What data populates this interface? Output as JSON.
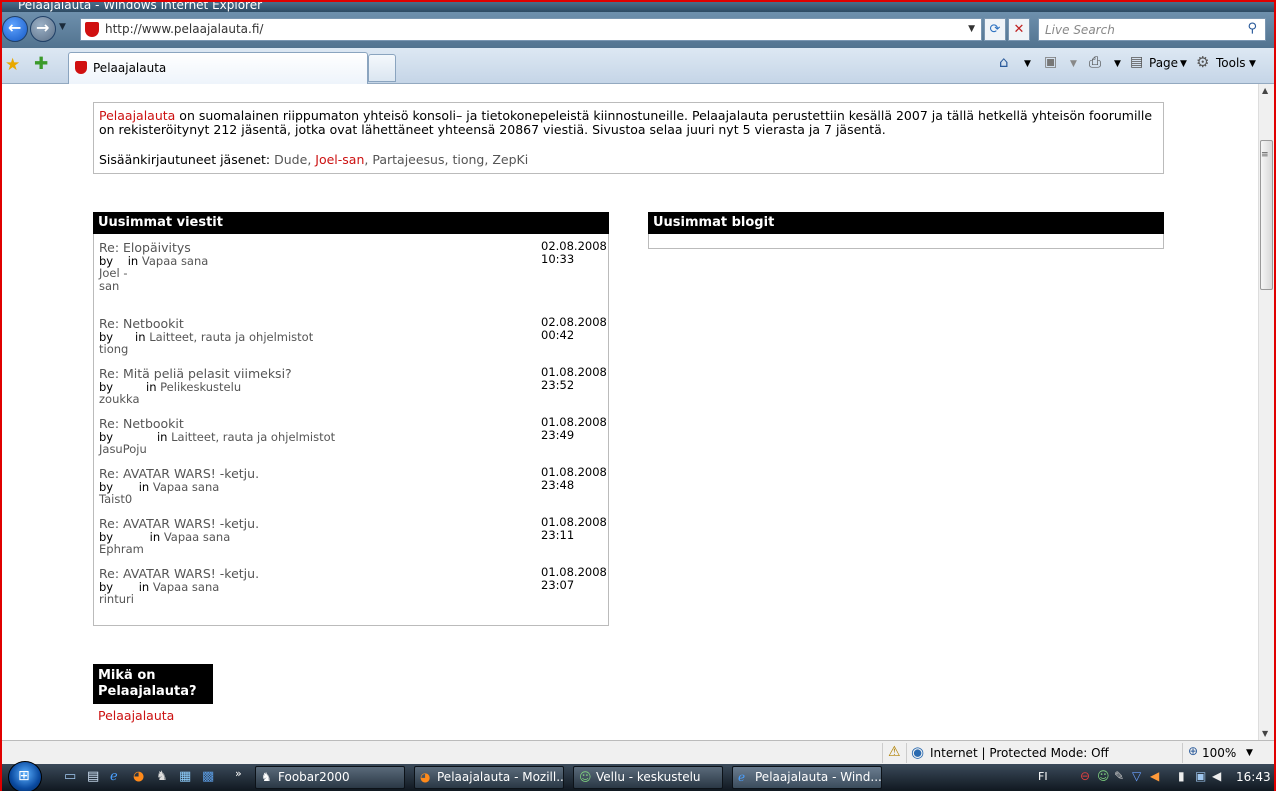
{
  "window": {
    "title": "Pelaajalauta - Windows Internet Explorer"
  },
  "address_bar": {
    "url": "http://www.pelaajalauta.fi/",
    "search_placeholder": "Live Search"
  },
  "tabs": [
    {
      "label": "Pelaajalauta"
    }
  ],
  "command_bar": {
    "page_label": "Page",
    "tools_label": "Tools"
  },
  "intro": {
    "site_link": "Pelaajalauta",
    "text": " on suomalainen riippumaton yhteisö konsoli– ja tietokonepeleistä kiinnostuneille. Pelaajalauta perustettiin kesällä 2007 ja tällä hetkellä yhteisön foorumille on rekisteröitynyt 212 jäsentä, jotka ovat lähettäneet yhteensä 20867 viestiä. Sivustoa selaa juuri nyt 5 vierasta ja 7 jäsentä.",
    "online_label": "Sisäänkirjautuneet jäsenet:",
    "online_members": [
      "Dude",
      "Joel-san",
      "Partajeesus",
      "tiong",
      "ZepKi"
    ]
  },
  "latest_posts": {
    "heading": "Uusimmat viestit",
    "posts": [
      {
        "title": "Re: Elopäivitys",
        "by": "by",
        "in": "in",
        "forum": "Vapaa sana",
        "author": "Joel - san",
        "date": "02.08.2008",
        "time": "10:33"
      },
      {
        "title": "Re: Netbookit",
        "by": "by",
        "in": "in",
        "forum": "Laitteet, rauta ja ohjelmistot",
        "author": "tiong",
        "date": "02.08.2008",
        "time": "00:42"
      },
      {
        "title": "Re: Mitä peliä pelasit viimeksi?",
        "by": "by",
        "in": "in",
        "forum": "Pelikeskustelu",
        "author": "zoukka",
        "date": "01.08.2008",
        "time": "23:52"
      },
      {
        "title": "Re: Netbookit",
        "by": "by",
        "in": "in",
        "forum": "Laitteet, rauta ja ohjelmistot",
        "author": "JasuPoju",
        "date": "01.08.2008",
        "time": "23:49"
      },
      {
        "title": "Re: AVATAR WARS! -ketju.",
        "by": "by",
        "in": "in",
        "forum": "Vapaa sana",
        "author": "Taist0",
        "date": "01.08.2008",
        "time": "23:48"
      },
      {
        "title": "Re: AVATAR WARS! -ketju.",
        "by": "by",
        "in": "in",
        "forum": "Vapaa sana",
        "author": "Ephram",
        "date": "01.08.2008",
        "time": "23:11"
      },
      {
        "title": "Re: AVATAR WARS! -ketju.",
        "by": "by",
        "in": "in",
        "forum": "Vapaa sana",
        "author": "rinturi",
        "date": "01.08.2008",
        "time": "23:07"
      }
    ]
  },
  "latest_blogs": {
    "heading": "Uusimmat blogit"
  },
  "about": {
    "heading": "Mikä on Pelaajalauta?",
    "link": "Pelaajalauta"
  },
  "status_bar": {
    "zone": "Internet | Protected Mode: Off",
    "zoom": "100%"
  },
  "taskbar": {
    "tasks": [
      {
        "label": "Foobar2000"
      },
      {
        "label": "Pelaajalauta - Mozill..."
      },
      {
        "label": "Vellu - keskustelu"
      },
      {
        "label": "Pelaajalauta - Wind..."
      }
    ],
    "language": "FI",
    "clock": "16:43"
  },
  "colors": {
    "accent_red": "#cc1111",
    "panel_header": "#000000",
    "link_gray": "#555555"
  }
}
